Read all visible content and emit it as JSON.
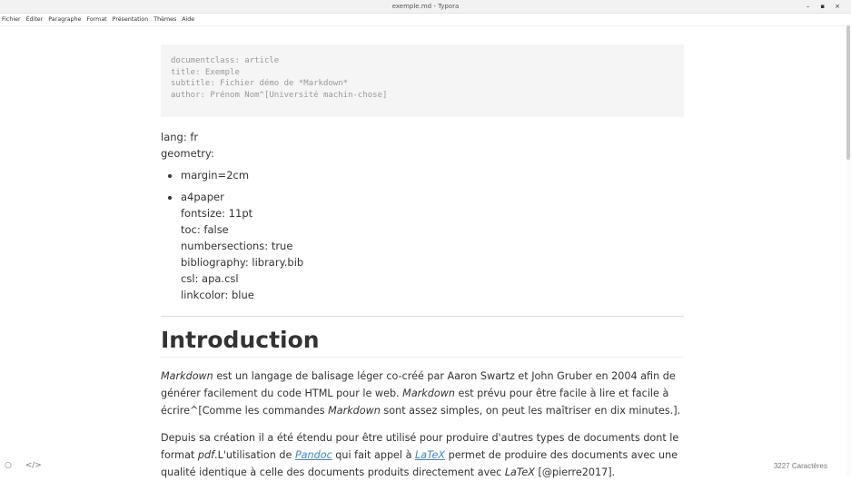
{
  "window": {
    "title": "exemple.md - Typora",
    "controls": [
      "–",
      "▪",
      "×"
    ]
  },
  "menu": [
    "Fichier",
    "Éditer",
    "Paragraphe",
    "Format",
    "Présentation",
    "Thèmes",
    "Aide"
  ],
  "frontmatter": [
    "documentclass: article",
    "title: Exemple",
    "subtitle: Fichier démo de *Markdown*",
    "author: Prénom Nom^[Université machin-chose]"
  ],
  "meta": {
    "lang": "lang: fr",
    "geometry": "geometry:"
  },
  "list": {
    "item1": "margin=2cm",
    "item2": "a4paper",
    "item2_lines": [
      "fontsize: 11pt",
      "toc: false",
      "numbersections: true",
      "bibliography: library.bib",
      "csl: apa.csl",
      "linkcolor: blue"
    ]
  },
  "heading": "Introduction",
  "para1": {
    "t1": "Markdown",
    "t2": " est un langage de balisage léger co-créé par Aaron Swartz et John Gruber en 2004 afin de générer facilement du code HTML pour le web. ",
    "t3": "Markdown",
    "t4": " est prévu pour être facile à lire et facile à écrire^[Comme les commandes ",
    "t5": "Markdown",
    "t6": " sont assez simples, on peut les maîtriser en dix minutes.]."
  },
  "para2": {
    "t1": "Depuis sa création il a été étendu pour être utilisé pour produire d'autres types de documents dont le format ",
    "t2": "pdf",
    "t3": ".L'utilisation de ",
    "t4": "Pandoc",
    "t5": " qui fait appel à ",
    "t6": "LaTeX",
    "t7": " permet de produire des documents avec une qualité identique à celle des documents produits directement avec ",
    "t8": "LaTeX",
    "t9": " [@pierre2017]."
  },
  "status": {
    "left_icons": [
      "○",
      "</>"
    ],
    "char_count": "3227 Caractères"
  }
}
